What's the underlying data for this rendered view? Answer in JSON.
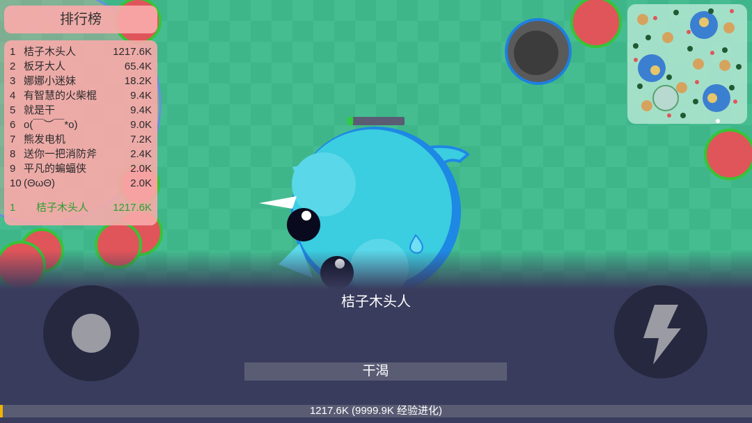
{
  "leaderboard": {
    "title": "排行榜",
    "entries": [
      {
        "rank": "1",
        "name": "桔子木头人",
        "score": "1217.6K"
      },
      {
        "rank": "2",
        "name": "板牙大人",
        "score": "65.4K"
      },
      {
        "rank": "3",
        "name": "娜娜小迷妹",
        "score": "18.2K"
      },
      {
        "rank": "4",
        "name": "有智慧的火柴棍",
        "score": "9.4K"
      },
      {
        "rank": "5",
        "name": "就是干",
        "score": "9.4K"
      },
      {
        "rank": "6",
        "name": "o(￣︶￣*o)",
        "score": "9.0K"
      },
      {
        "rank": "7",
        "name": "熊发电机",
        "score": "7.2K"
      },
      {
        "rank": "8",
        "name": "送你一把消防斧",
        "score": "2.4K"
      },
      {
        "rank": "9",
        "name": "平凡的蝙蝠侠",
        "score": "2.0K"
      },
      {
        "rank": "10",
        "name": "(ΘωΘ)",
        "score": "2.0K"
      }
    ],
    "self": {
      "rank": "1",
      "name": "桔子木头人",
      "score": "1217.6K"
    }
  },
  "player": {
    "name": "桔子木头人",
    "status": "干渴",
    "water_level": 0.1
  },
  "xp": {
    "label": "1217.6K (9999.9K 经验进化)",
    "progress": 0.004
  },
  "icons": {
    "boost": "lightning-icon",
    "joystick": "joystick-knob"
  },
  "colors": {
    "ground": "#3fb68a",
    "hud": "#3a3c5d",
    "leaderboard": "#f8aaaa",
    "self_highlight": "#2e9e2e",
    "player_body": "#3bcde0",
    "player_outline": "#1e88e5",
    "berry": "#e0555a",
    "xp_fill": "#f0b400"
  }
}
